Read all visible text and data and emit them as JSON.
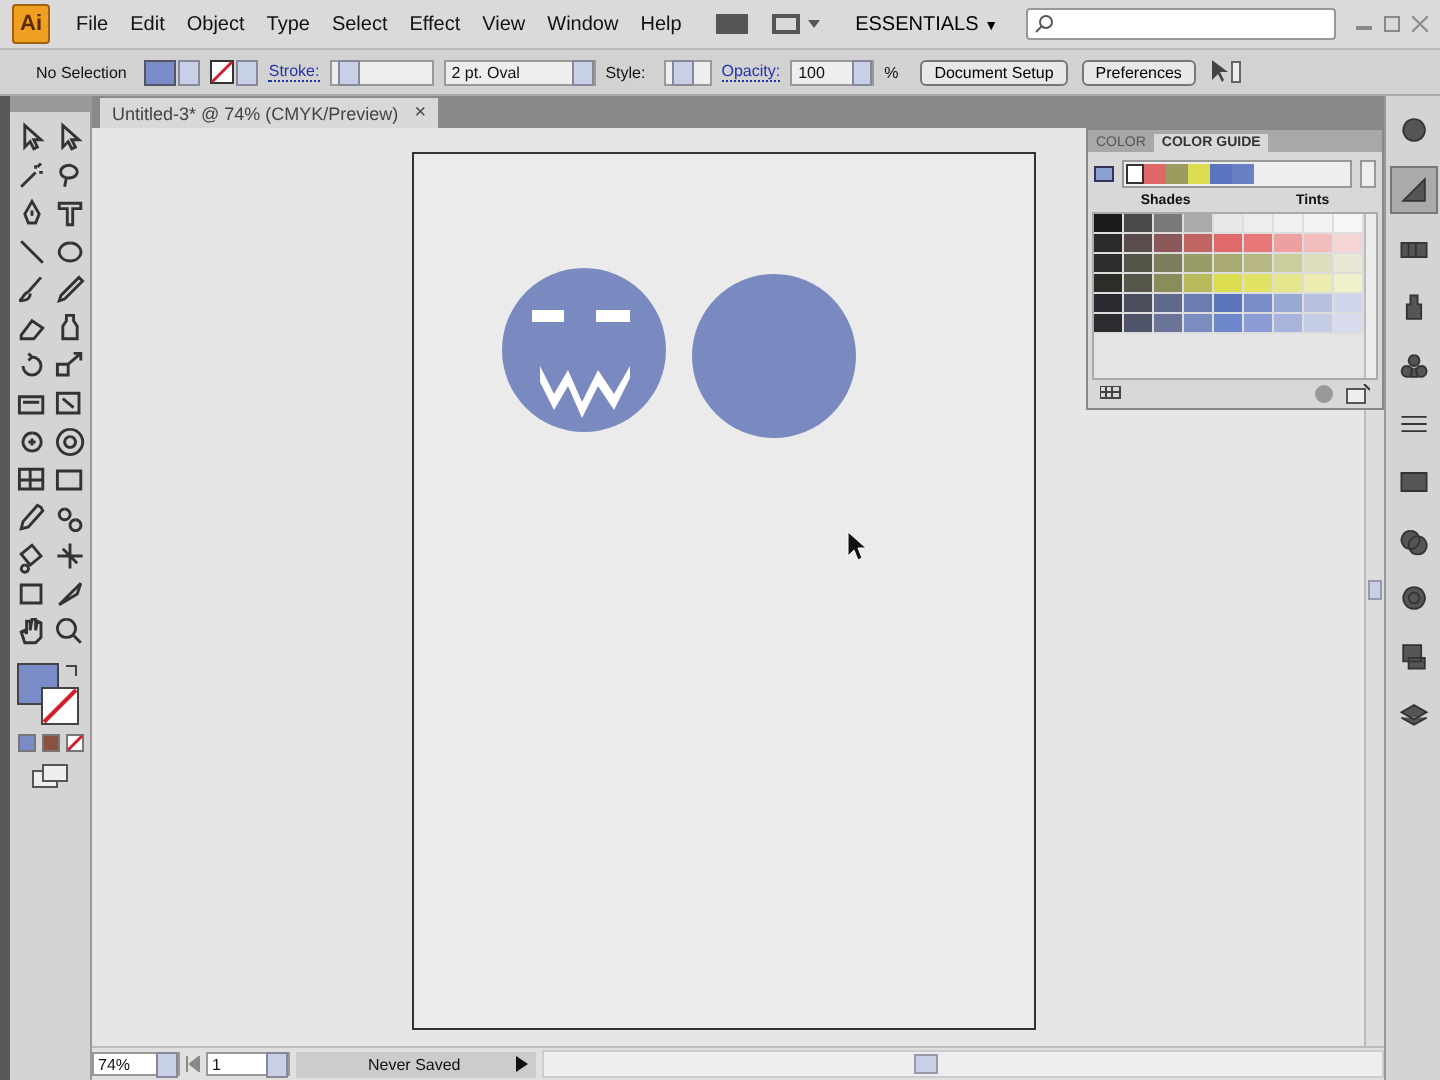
{
  "app": {
    "logo": "Ai",
    "menus": [
      "File",
      "Edit",
      "Object",
      "Type",
      "Select",
      "Effect",
      "View",
      "Window",
      "Help"
    ],
    "workspace": "ESSENTIALS",
    "workspace_caret": "▼"
  },
  "control_bar": {
    "selection": "No Selection",
    "stroke_label": "Stroke:",
    "brush": "2 pt. Oval",
    "style_label": "Style:",
    "opacity_label": "Opacity:",
    "opacity": "100",
    "opacity_unit": "%",
    "buttons": [
      "Document Setup",
      "Preferences"
    ]
  },
  "document_tab": {
    "title": "Untitled-3* @ 74% (CMYK/Preview)",
    "close": "×"
  },
  "color_panel": {
    "tabs": [
      {
        "label": "COLOR",
        "selected": false
      },
      {
        "label": "COLOR GUIDE",
        "selected": true
      }
    ],
    "harmony": [
      {
        "color": "#ffffff"
      },
      {
        "color": "#e06868"
      },
      {
        "color": "#9a9c60"
      },
      {
        "color": "#dcdc50"
      },
      {
        "color": "#5a74c0"
      },
      {
        "color": "#6a80c4"
      }
    ],
    "shades_label": "Shades",
    "tints_label": "Tints",
    "grid": [
      {
        "cells": [
          {
            "color": "#1a1a1a"
          },
          {
            "color": "#4a4a4a"
          },
          {
            "color": "#7a7a7a"
          },
          {
            "color": "#aaaaaa"
          },
          {
            "color": "#e8e8e8"
          },
          {
            "color": "#ededed"
          },
          {
            "color": "#f0f0f0"
          },
          {
            "color": "#f3f3f3"
          },
          {
            "color": "#f6f6f6"
          }
        ]
      },
      {
        "cells": [
          {
            "color": "#2a2a2a"
          },
          {
            "color": "#5a4c4c"
          },
          {
            "color": "#8a5a5a"
          },
          {
            "color": "#c06464"
          },
          {
            "color": "#e06a6a"
          },
          {
            "color": "#e87878"
          },
          {
            "color": "#eea0a0"
          },
          {
            "color": "#f2bcbc"
          },
          {
            "color": "#f4d4d4"
          }
        ]
      },
      {
        "cells": [
          {
            "color": "#2c2c2a"
          },
          {
            "color": "#55564a"
          },
          {
            "color": "#7c7e5c"
          },
          {
            "color": "#9a9c68"
          },
          {
            "color": "#a8aa70"
          },
          {
            "color": "#b8b982"
          },
          {
            "color": "#cccd9e"
          },
          {
            "color": "#dcddbc"
          },
          {
            "color": "#e8e8d4"
          }
        ]
      },
      {
        "cells": [
          {
            "color": "#2c2c28"
          },
          {
            "color": "#56574a"
          },
          {
            "color": "#8a8c5c"
          },
          {
            "color": "#b8ba5c"
          },
          {
            "color": "#dcdc50"
          },
          {
            "color": "#e2e264"
          },
          {
            "color": "#e6e68c"
          },
          {
            "color": "#ececb0"
          },
          {
            "color": "#f0f0cc"
          }
        ]
      },
      {
        "cells": [
          {
            "color": "#2a2a30"
          },
          {
            "color": "#4a4e5c"
          },
          {
            "color": "#5e6a8c"
          },
          {
            "color": "#6a7cb0"
          },
          {
            "color": "#5c74bc"
          },
          {
            "color": "#7a8cc8"
          },
          {
            "color": "#9aa8d4"
          },
          {
            "color": "#b8c2e0"
          },
          {
            "color": "#d0d6ea"
          }
        ]
      },
      {
        "cells": [
          {
            "color": "#2c2c30"
          },
          {
            "color": "#505468"
          },
          {
            "color": "#6a7498"
          },
          {
            "color": "#7a8cc0"
          },
          {
            "color": "#6e86cc"
          },
          {
            "color": "#8c9cd4"
          },
          {
            "color": "#a8b4dc"
          },
          {
            "color": "#c4cce6"
          },
          {
            "color": "#d8dcee"
          }
        ]
      }
    ]
  },
  "status_bar": {
    "zoom": "74%",
    "page": "1",
    "status": "Never Saved"
  }
}
